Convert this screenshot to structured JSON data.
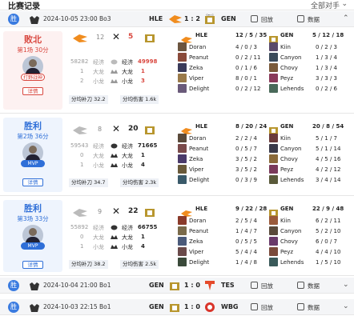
{
  "header": {
    "title": "比赛记录",
    "filter": "全部对手"
  },
  "matches": [
    {
      "result": "胜",
      "date": "2024-10-05 23:00 Bo3",
      "team1": "HLE",
      "score": "1 : 2",
      "team2": "GEN",
      "replay": "回放",
      "stats": "数据"
    },
    {
      "result": "胜",
      "date": "2024-10-04 21:00 Bo1",
      "team1": "GEN",
      "score": "1 : 0",
      "team2": "TES",
      "replay": "回放",
      "stats": "数据"
    },
    {
      "result": "胜",
      "date": "2024-10-03 22:15 Bo1",
      "team1": "GEN",
      "score": "1 : 0",
      "team2": "WBG",
      "replay": "回放",
      "stats": "数据"
    }
  ],
  "games": [
    {
      "result": "败北",
      "outcome": "lose",
      "game_label": "第1场 30分",
      "pill": "打野战神",
      "detail": "详情",
      "kills_left": "12",
      "kills_right": "5",
      "gold_left": "58282",
      "gold_label": "经济",
      "gold_right": "49998",
      "dragon_left": "1",
      "dragon_label": "大龙",
      "dragon_right": "1",
      "baron_left": "2",
      "baron_label": "小龙",
      "baron_right": "3",
      "avg_cs_label": "分均补刀",
      "avg_cs": "32.2",
      "avg_dmg_label": "分均伤害",
      "avg_dmg": "1.6k",
      "team_a": {
        "name": "HLE",
        "kda": "12 / 5 / 35"
      },
      "team_b": {
        "name": "GEN",
        "kda": "5 / 12 / 18"
      },
      "players_a": [
        {
          "name": "Doran",
          "kda": "4 / 0 / 3"
        },
        {
          "name": "Peanut",
          "kda": "0 / 2 / 11"
        },
        {
          "name": "Zeka",
          "kda": "0 / 1 / 6"
        },
        {
          "name": "Viper",
          "kda": "8 / 0 / 1"
        },
        {
          "name": "Delight",
          "kda": "0 / 2 / 12"
        }
      ],
      "players_b": [
        {
          "name": "Kiin",
          "kda": "0 / 2 / 3"
        },
        {
          "name": "Canyon",
          "kda": "1 / 3 / 4"
        },
        {
          "name": "Chovy",
          "kda": "1 / 3 / 4"
        },
        {
          "name": "Peyz",
          "kda": "3 / 3 / 3"
        },
        {
          "name": "Lehends",
          "kda": "0 / 2 / 6"
        }
      ]
    },
    {
      "result": "胜利",
      "outcome": "win",
      "game_label": "第2场 36分",
      "pill": "MVP",
      "detail": "详情",
      "kills_left": "8",
      "kills_right": "20",
      "gold_left": "59543",
      "gold_label": "经济",
      "gold_right": "71665",
      "dragon_left": "0",
      "dragon_label": "大龙",
      "dragon_right": "1",
      "baron_left": "1",
      "baron_label": "小龙",
      "baron_right": "4",
      "avg_cs_label": "分均补刀",
      "avg_cs": "34.7",
      "avg_dmg_label": "分均伤害",
      "avg_dmg": "2.3k",
      "team_a": {
        "name": "HLE",
        "kda": "8 / 20 / 24"
      },
      "team_b": {
        "name": "GEN",
        "kda": "20 / 8 / 54"
      },
      "players_a": [
        {
          "name": "Doran",
          "kda": "2 / 2 / 4"
        },
        {
          "name": "Peanut",
          "kda": "0 / 5 / 7"
        },
        {
          "name": "Zeka",
          "kda": "3 / 5 / 2"
        },
        {
          "name": "Viper",
          "kda": "3 / 5 / 2"
        },
        {
          "name": "Delight",
          "kda": "0 / 3 / 9"
        }
      ],
      "players_b": [
        {
          "name": "Kiin",
          "kda": "5 / 1 / 7"
        },
        {
          "name": "Canyon",
          "kda": "5 / 1 / 14"
        },
        {
          "name": "Chovy",
          "kda": "4 / 5 / 16"
        },
        {
          "name": "Peyz",
          "kda": "4 / 2 / 12"
        },
        {
          "name": "Lehends",
          "kda": "3 / 4 / 14"
        }
      ]
    },
    {
      "result": "胜利",
      "outcome": "win",
      "game_label": "第3场 33分",
      "pill": "MVP",
      "detail": "详情",
      "kills_left": "9",
      "kills_right": "22",
      "gold_left": "55892",
      "gold_label": "经济",
      "gold_right": "66755",
      "dragon_left": "0",
      "dragon_label": "大龙",
      "dragon_right": "1",
      "baron_left": "1",
      "baron_label": "小龙",
      "baron_right": "4",
      "avg_cs_label": "分均补刀",
      "avg_cs": "38.2",
      "avg_dmg_label": "分均伤害",
      "avg_dmg": "2.5k",
      "team_a": {
        "name": "HLE",
        "kda": "9 / 22 / 28"
      },
      "team_b": {
        "name": "GEN",
        "kda": "22 / 9 / 48"
      },
      "players_a": [
        {
          "name": "Doran",
          "kda": "2 / 5 / 4"
        },
        {
          "name": "Peanut",
          "kda": "1 / 4 / 7"
        },
        {
          "name": "Zeka",
          "kda": "0 / 5 / 5"
        },
        {
          "name": "Viper",
          "kda": "5 / 4 / 4"
        },
        {
          "name": "Delight",
          "kda": "1 / 4 / 8"
        }
      ],
      "players_b": [
        {
          "name": "Kiin",
          "kda": "6 / 2 / 11"
        },
        {
          "name": "Canyon",
          "kda": "5 / 2 / 10"
        },
        {
          "name": "Chovy",
          "kda": "6 / 0 / 7"
        },
        {
          "name": "Peyz",
          "kda": "4 / 4 / 10"
        },
        {
          "name": "Lehends",
          "kda": "1 / 5 / 10"
        }
      ]
    }
  ],
  "colors": {
    "accent": "#2f6fd8",
    "lose": "#d9473f",
    "hle": "#f08c1e",
    "gen": "#b8962e"
  }
}
